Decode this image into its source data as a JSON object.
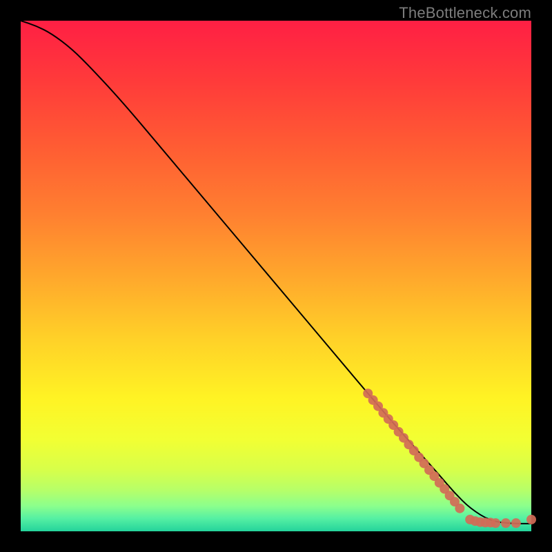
{
  "watermark": "TheBottleneck.com",
  "chart_data": {
    "type": "line",
    "title": "",
    "xlabel": "",
    "ylabel": "",
    "xlim": [
      0,
      100
    ],
    "ylim": [
      0,
      100
    ],
    "grid": false,
    "legend": false,
    "gradient_stops": [
      {
        "pos": 0.0,
        "color": "#ff1f44"
      },
      {
        "pos": 0.12,
        "color": "#ff3b3a"
      },
      {
        "pos": 0.25,
        "color": "#ff5d33"
      },
      {
        "pos": 0.38,
        "color": "#ff8030"
      },
      {
        "pos": 0.5,
        "color": "#ffa72c"
      },
      {
        "pos": 0.62,
        "color": "#ffd028"
      },
      {
        "pos": 0.74,
        "color": "#fff324"
      },
      {
        "pos": 0.82,
        "color": "#f2ff33"
      },
      {
        "pos": 0.88,
        "color": "#d7ff4a"
      },
      {
        "pos": 0.92,
        "color": "#b6ff69"
      },
      {
        "pos": 0.95,
        "color": "#8cff8c"
      },
      {
        "pos": 0.975,
        "color": "#55f0a3"
      },
      {
        "pos": 1.0,
        "color": "#24d39b"
      }
    ],
    "series": [
      {
        "name": "curve",
        "type": "line",
        "color": "#000000",
        "x": [
          0,
          3,
          6,
          10,
          14,
          20,
          28,
          36,
          44,
          52,
          60,
          68,
          74,
          78,
          82,
          85,
          88,
          92,
          96,
          100
        ],
        "y": [
          100,
          99,
          97.5,
          94.5,
          90.5,
          84,
          74.5,
          65,
          55.5,
          46,
          36.5,
          27,
          20,
          15.5,
          11,
          7.5,
          4.5,
          2,
          1.5,
          1.5
        ]
      },
      {
        "name": "highlighted-band",
        "type": "scatter",
        "color": "#d16b57",
        "marker_radius_px": 7,
        "x": [
          68,
          69,
          70,
          71,
          72,
          73,
          74,
          75,
          76,
          77,
          78,
          79,
          80,
          81,
          82,
          83,
          84,
          85,
          86,
          88,
          89,
          90,
          91,
          92,
          93,
          95,
          97,
          100
        ],
        "y": [
          27,
          25.7,
          24.5,
          23.2,
          22,
          20.8,
          19.5,
          18.3,
          17,
          15.8,
          14.5,
          13.3,
          12,
          10.8,
          9.5,
          8.3,
          7,
          5.8,
          4.5,
          2.3,
          2,
          1.8,
          1.7,
          1.7,
          1.6,
          1.6,
          1.6,
          2.3
        ]
      }
    ]
  }
}
